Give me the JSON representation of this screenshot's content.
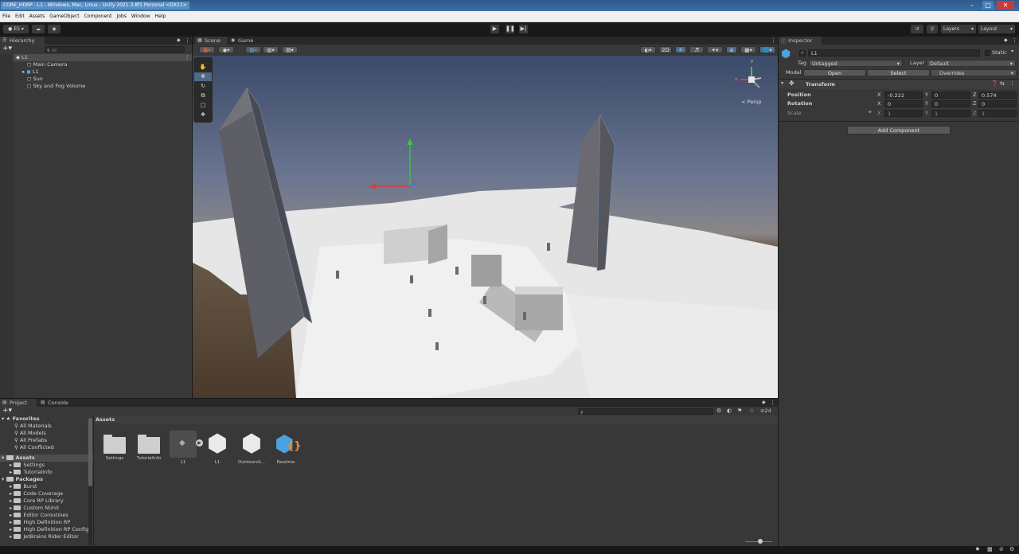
{
  "window": {
    "title": "CORE_HDRP - L1 - Windows, Mac, Linux - Unity 2021.3.8f1 Personal <DX11>"
  },
  "menu": [
    "File",
    "Edit",
    "Assets",
    "GameObject",
    "Component",
    "Jobs",
    "Window",
    "Help"
  ],
  "toolbar": {
    "account": "ES",
    "layers": "Layers",
    "layout": "Layout"
  },
  "hierarchy": {
    "tab": "Hierarchy",
    "search_placeholder": "All",
    "scene": "L1",
    "items": [
      "Main Camera",
      "L1",
      "Sun",
      "Sky and Fog Volume"
    ]
  },
  "scene": {
    "tabs": [
      "Scene",
      "Game"
    ],
    "mode_2d": "2D",
    "persp": "< Persp",
    "gizmo": {
      "x": "x",
      "y": "y"
    }
  },
  "inspector": {
    "tab": "Inspector",
    "object_name": "L1",
    "static_label": "Static",
    "tag_label": "Tag",
    "tag_value": "Untagged",
    "layer_label": "Layer",
    "layer_value": "Default",
    "model_label": "Model",
    "open": "Open",
    "select": "Select",
    "overrides": "Overrides",
    "transform_title": "Transform",
    "position_label": "Position",
    "position": {
      "x": "-0.222",
      "y": "0",
      "z": "0.574"
    },
    "rotation_label": "Rotation",
    "rotation": {
      "x": "0",
      "y": "0",
      "z": "0"
    },
    "scale_label": "Scale",
    "scale": {
      "x": "1",
      "y": "1",
      "z": "1"
    },
    "axis": {
      "x": "X",
      "y": "Y",
      "z": "Z"
    },
    "add_component": "Add Component"
  },
  "project": {
    "tabs": [
      "Project",
      "Console"
    ],
    "favorites_label": "Favorites",
    "favorites": [
      "All Materials",
      "All Models",
      "All Prefabs",
      "All Conflicted"
    ],
    "assets_label": "Assets",
    "assets_tree": [
      "Settings",
      "TutorialInfo"
    ],
    "packages_label": "Packages",
    "packages": [
      "Burst",
      "Code Coverage",
      "Core RP Library",
      "Custom NUnit",
      "Editor Coroutines",
      "High Definition RP",
      "High Definition RP Config",
      "JetBrains Rider Editor"
    ],
    "breadcrumb": "Assets",
    "hidden_count": "24",
    "grid": [
      "Settings",
      "TutorialInfo",
      "L1",
      "L1",
      "OutdoorsS...",
      "Readme"
    ]
  },
  "colors": {
    "accent": "#2c5d87",
    "unity_blue": "#4aa3df",
    "readme_orange": "#f08a2e"
  }
}
